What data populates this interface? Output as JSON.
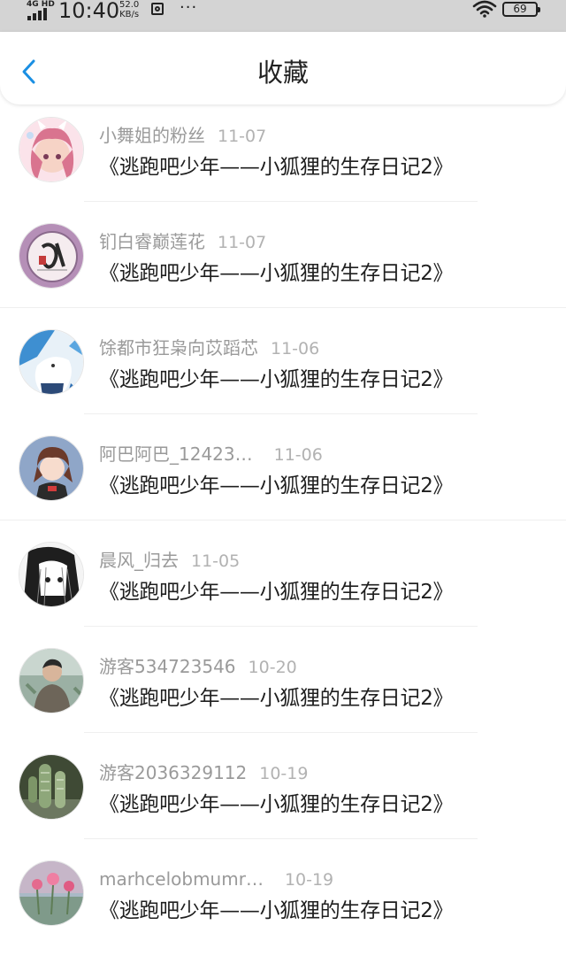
{
  "status_bar": {
    "network": "4G HD",
    "time": "10:40",
    "speed_value": "52.0",
    "speed_unit": "KB/s",
    "more": "···",
    "battery": "69"
  },
  "header": {
    "title": "收藏"
  },
  "items": [
    {
      "name": "小舞姐的粉丝",
      "date": "11-07",
      "book": "《逃跑吧少年——小狐狸的生存日记2》"
    },
    {
      "name": "钔白睿巅莲花",
      "date": "11-07",
      "book": "《逃跑吧少年——小狐狸的生存日记2》"
    },
    {
      "name": "馀都市狂枭向苡蹈芯",
      "date": "11-06",
      "book": "《逃跑吧少年——小狐狸的生存日记2》"
    },
    {
      "name": "阿巴阿巴_12423…",
      "date": "11-06",
      "book": "《逃跑吧少年——小狐狸的生存日记2》"
    },
    {
      "name": "晨风_归去",
      "date": "11-05",
      "book": "《逃跑吧少年——小狐狸的生存日记2》"
    },
    {
      "name": "游客534723546",
      "date": "10-20",
      "book": "《逃跑吧少年——小狐狸的生存日记2》"
    },
    {
      "name": "游客2036329112",
      "date": "10-19",
      "book": "《逃跑吧少年——小狐狸的生存日记2》"
    },
    {
      "name": "marhcelobmumr…",
      "date": "10-19",
      "book": "《逃跑吧少年——小狐狸的生存日记2》"
    }
  ],
  "colors": {
    "accent": "#1a8fe3",
    "name_text": "#9a9a9a",
    "date_text": "#b2b2b2",
    "title_text": "#1f1f1f"
  }
}
